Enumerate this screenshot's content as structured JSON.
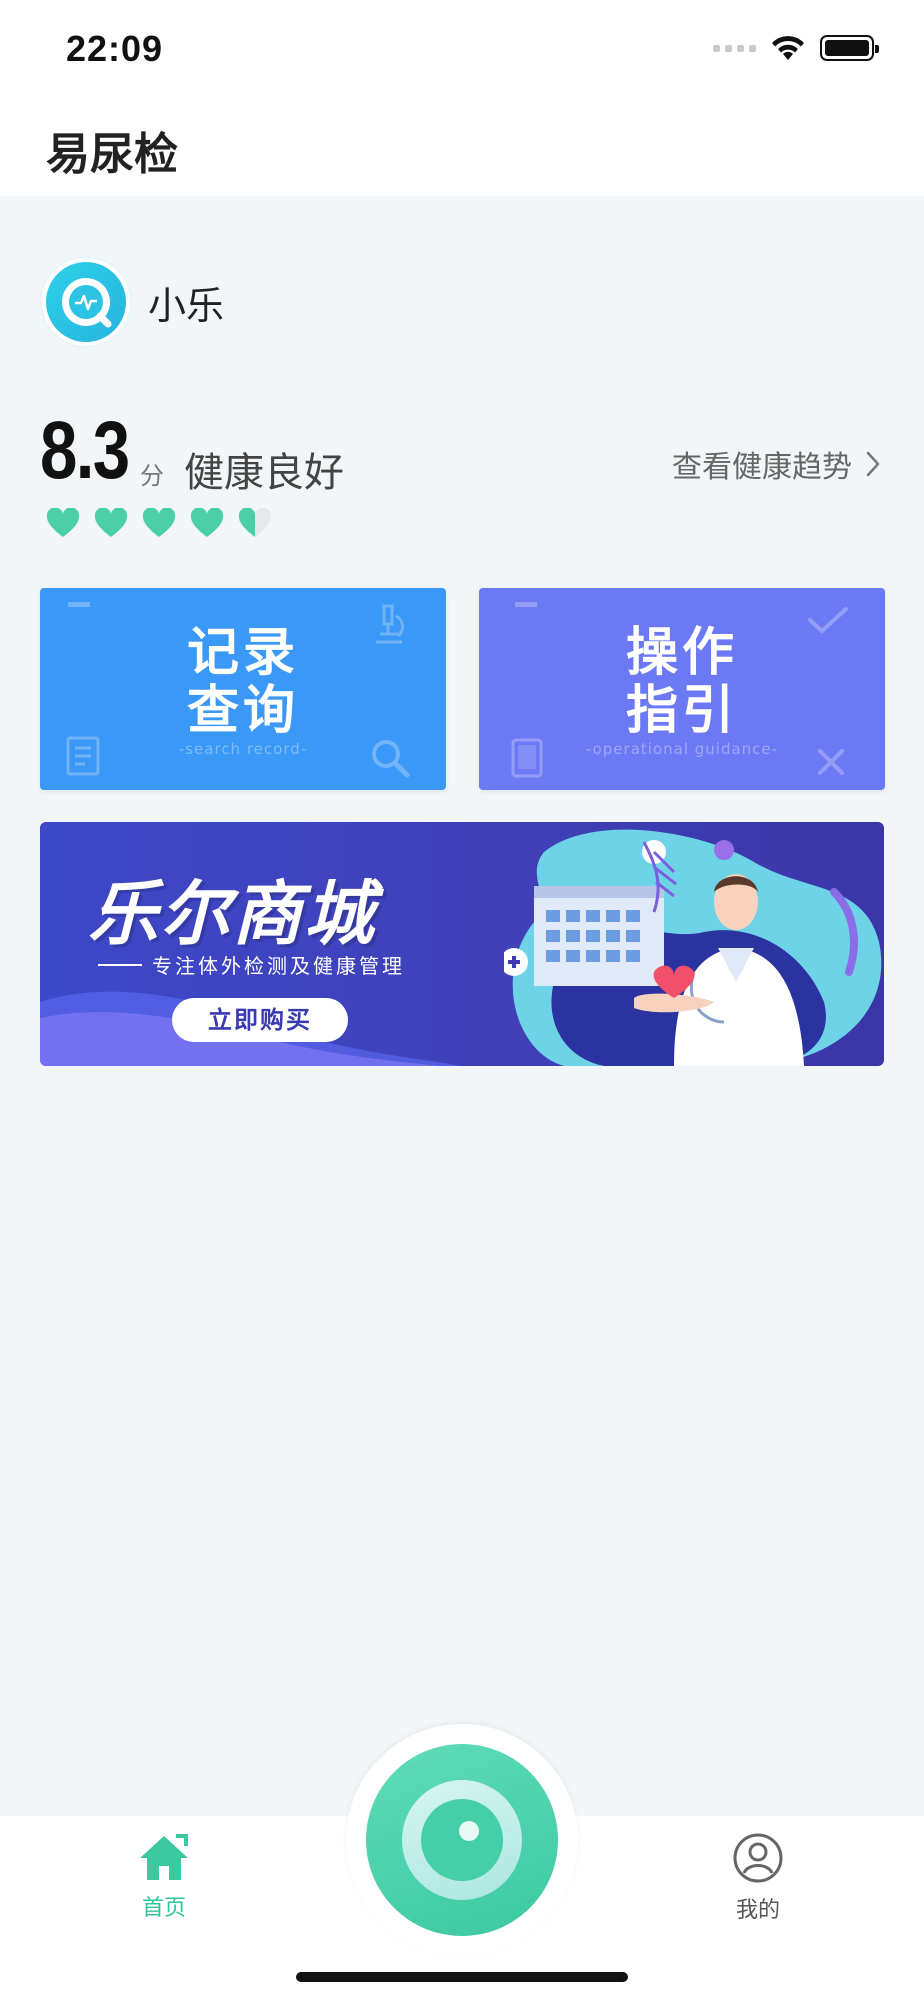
{
  "status_bar": {
    "time": "22:09"
  },
  "app_bar": {
    "title": "易尿检"
  },
  "profile": {
    "name": "小乐"
  },
  "health": {
    "score": "8.3",
    "unit": "分",
    "status": "健康良好",
    "trend_link": "查看健康趋势",
    "hearts_filled": 4.5,
    "hearts_total": 5
  },
  "cards": {
    "record": {
      "title_line1": "记录",
      "title_line2": "查询",
      "subtitle": "-search record-",
      "color": "#3a98f6"
    },
    "guide": {
      "title_line1": "操作",
      "title_line2": "指引",
      "subtitle": "-operational guidance-",
      "color": "#6c79f5"
    }
  },
  "banner": {
    "title": "乐尔商城",
    "subtitle": "专注体外检测及健康管理",
    "button": "立即购买"
  },
  "tabs": {
    "home": "首页",
    "mine": "我的"
  },
  "colors": {
    "accent": "#2fc59a",
    "background": "#f3f6f9"
  }
}
